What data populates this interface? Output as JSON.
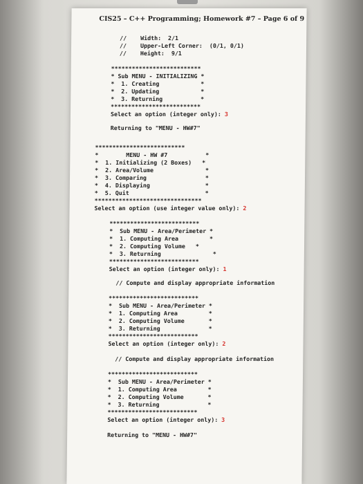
{
  "header": "CIS25 – C++ Programming; Homework #7 – Page 6 of 9",
  "lines": [
    "//    Width:  2/1",
    "//    Upper-Left Corner:  (0/1, 0/1)",
    "//    Height:  9/1",
    "**************************",
    "* Sub MENU - INITIALIZING *",
    "*  1. Creating            *",
    "*  2. Updating            *",
    "*  3. Returning           *",
    "**************************",
    "Select an option (integer only): ",
    "Returning to \"MENU - HW#7\"",
    "**************************",
    "*        MENU - HW #7           *",
    "*  1. Initializing (2 Boxes)   *",
    "*  2. Area/Volume               *",
    "*  3. Comparing                 *",
    "*  4. Displaying                *",
    "*  5. Quit                      *",
    "*******************************",
    "Select an option (use integer value only): ",
    "**************************",
    "*  Sub MENU - Area/Perimeter *",
    "*  1. Computing Area         *",
    "*  2. Computing Volume   *",
    "*  3. Returning               *",
    "**************************",
    "Select an option (integer only): ",
    "// Compute and display appropriate information",
    "**************************",
    "*  Sub MENU - Area/Perimeter *",
    "*  1. Computing Area         *",
    "*  2. Computing Volume       *",
    "*  3. Returning              *",
    "**************************",
    "Select an option (integer only): ",
    "// Compute and display appropriate information",
    "**************************",
    "*  Sub MENU - Area/Perimeter *",
    "*  1. Computing Area         *",
    "*  2. Computing Volume       *",
    "*  3. Returning              *",
    "**************************",
    "Select an option (integer only): ",
    "Returning to \"MENU - HW#7\""
  ],
  "inputs": [
    "3",
    "2",
    "1",
    "2",
    "3"
  ]
}
